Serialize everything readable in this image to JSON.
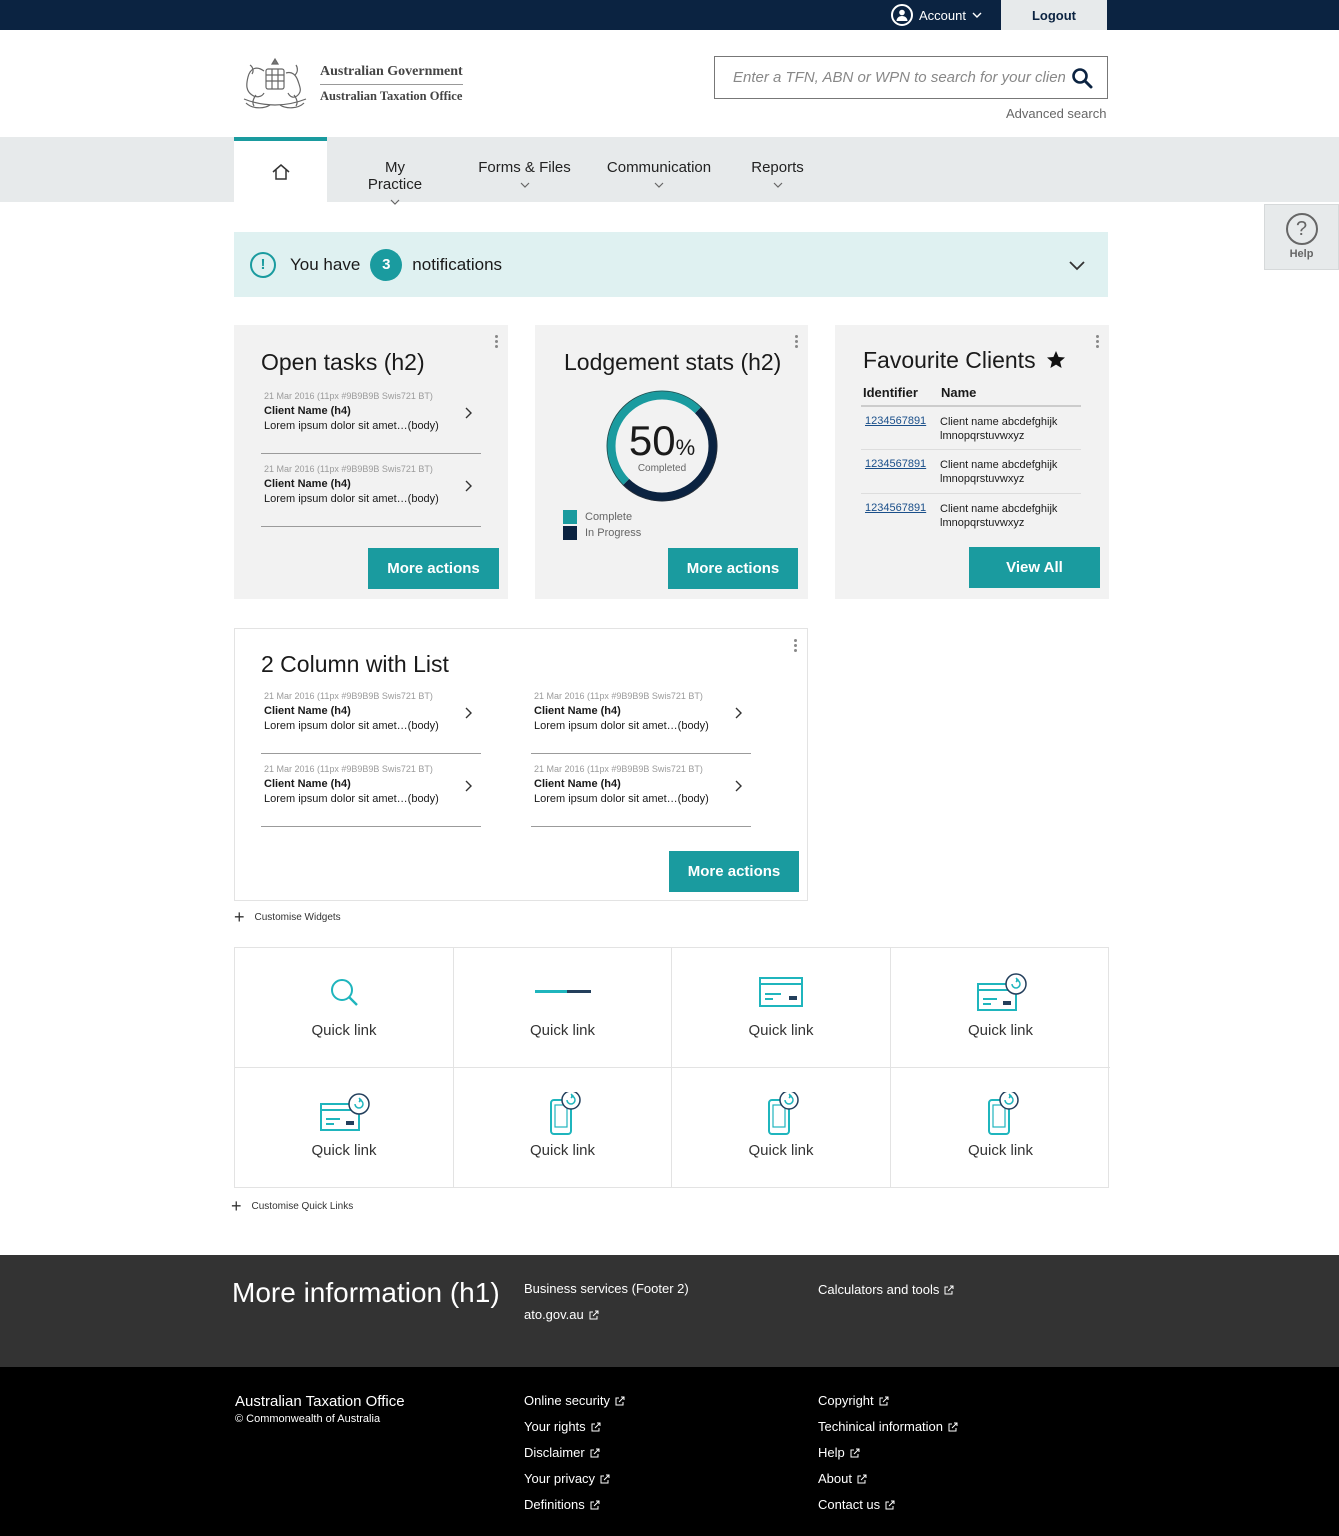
{
  "topbar": {
    "account_label": "Account",
    "logout_label": "Logout"
  },
  "header": {
    "logo_line1": "Australian Government",
    "logo_line2": "Australian Taxation Office",
    "search_placeholder": "Enter a TFN, ABN or WPN to search for your client",
    "advanced_search": "Advanced search"
  },
  "nav": {
    "items": [
      {
        "label": "My Practice"
      },
      {
        "label": "Forms & Files"
      },
      {
        "label": "Communication"
      },
      {
        "label": "Reports"
      }
    ]
  },
  "help": {
    "label": "Help"
  },
  "notifications": {
    "prefix": "You have",
    "count": "3",
    "suffix": "notifications"
  },
  "open_tasks": {
    "title": "Open tasks (h2)",
    "items": [
      {
        "meta": "21 Mar 2016  (11px #9B9B9B Swis721 BT)",
        "name": "Client Name (h4)",
        "body": "Lorem ipsum dolor sit amet…(body)"
      },
      {
        "meta": "21 Mar 2016  (11px #9B9B9B Swis721 BT)",
        "name": "Client Name (h4)",
        "body": "Lorem ipsum dolor sit amet…(body)"
      }
    ],
    "button": "More actions"
  },
  "lodgement": {
    "title": "Lodgement stats (h2)",
    "percent": "50",
    "percent_sign": "%",
    "completed_label": "Completed",
    "legend": [
      "Complete",
      "In Progress"
    ],
    "button": "More actions"
  },
  "favourites": {
    "title": "Favourite Clients",
    "col_identifier": "Identifier",
    "col_name": "Name",
    "rows": [
      {
        "id": "1234567891",
        "name": "Client name abcdefghijk lmnopqrstuvwxyz"
      },
      {
        "id": "1234567891",
        "name": "Client name abcdefghijk lmnopqrstuvwxyz"
      },
      {
        "id": "1234567891",
        "name": "Client name abcdefghijk lmnopqrstuvwxyz"
      }
    ],
    "button": "View All"
  },
  "two_col": {
    "title": "2 Column with List",
    "items": [
      {
        "meta": "21 Mar 2016  (11px #9B9B9B Swis721 BT)",
        "name": "Client Name (h4)",
        "body": "Lorem ipsum dolor sit amet…(body)"
      },
      {
        "meta": "21 Mar 2016  (11px #9B9B9B Swis721 BT)",
        "name": "Client Name (h4)",
        "body": "Lorem ipsum dolor sit amet…(body)"
      },
      {
        "meta": "21 Mar 2016  (11px #9B9B9B Swis721 BT)",
        "name": "Client Name (h4)",
        "body": "Lorem ipsum dolor sit amet…(body)"
      },
      {
        "meta": "21 Mar 2016  (11px #9B9B9B Swis721 BT)",
        "name": "Client Name (h4)",
        "body": "Lorem ipsum dolor sit amet…(body)"
      }
    ],
    "button": "More actions"
  },
  "customise_widgets": "Customise  Widgets",
  "quick_links": [
    {
      "label": "Quick link",
      "icon": "search-icon"
    },
    {
      "label": "Quick link",
      "icon": "progress-bar-icon"
    },
    {
      "label": "Quick link",
      "icon": "card-icon"
    },
    {
      "label": "Quick link",
      "icon": "card-refresh-icon"
    },
    {
      "label": "Quick link",
      "icon": "card-refresh-icon"
    },
    {
      "label": "Quick link",
      "icon": "phone-refresh-icon"
    },
    {
      "label": "Quick link",
      "icon": "phone-refresh-icon"
    },
    {
      "label": "Quick link",
      "icon": "phone-refresh-icon"
    }
  ],
  "customise_quick_links": "Customise Quick Links",
  "footer": {
    "title": "More information (h1)",
    "links_top": [
      "Business services (Footer 2)",
      "ato.gov.au",
      "Calculators and tools"
    ],
    "org_name": "Australian Taxation Office",
    "copyright": "© Commonwealth of Australia",
    "col1": [
      "Online security",
      "Your rights",
      "Disclaimer",
      "Your privacy",
      "Definitions"
    ],
    "col2": [
      "Copyright",
      "Techinical information",
      "Help",
      "About",
      "Contact us"
    ]
  },
  "colors": {
    "accent": "#1a9b9f",
    "navy": "#0b2341",
    "notification_bg": "#dff1f1"
  }
}
